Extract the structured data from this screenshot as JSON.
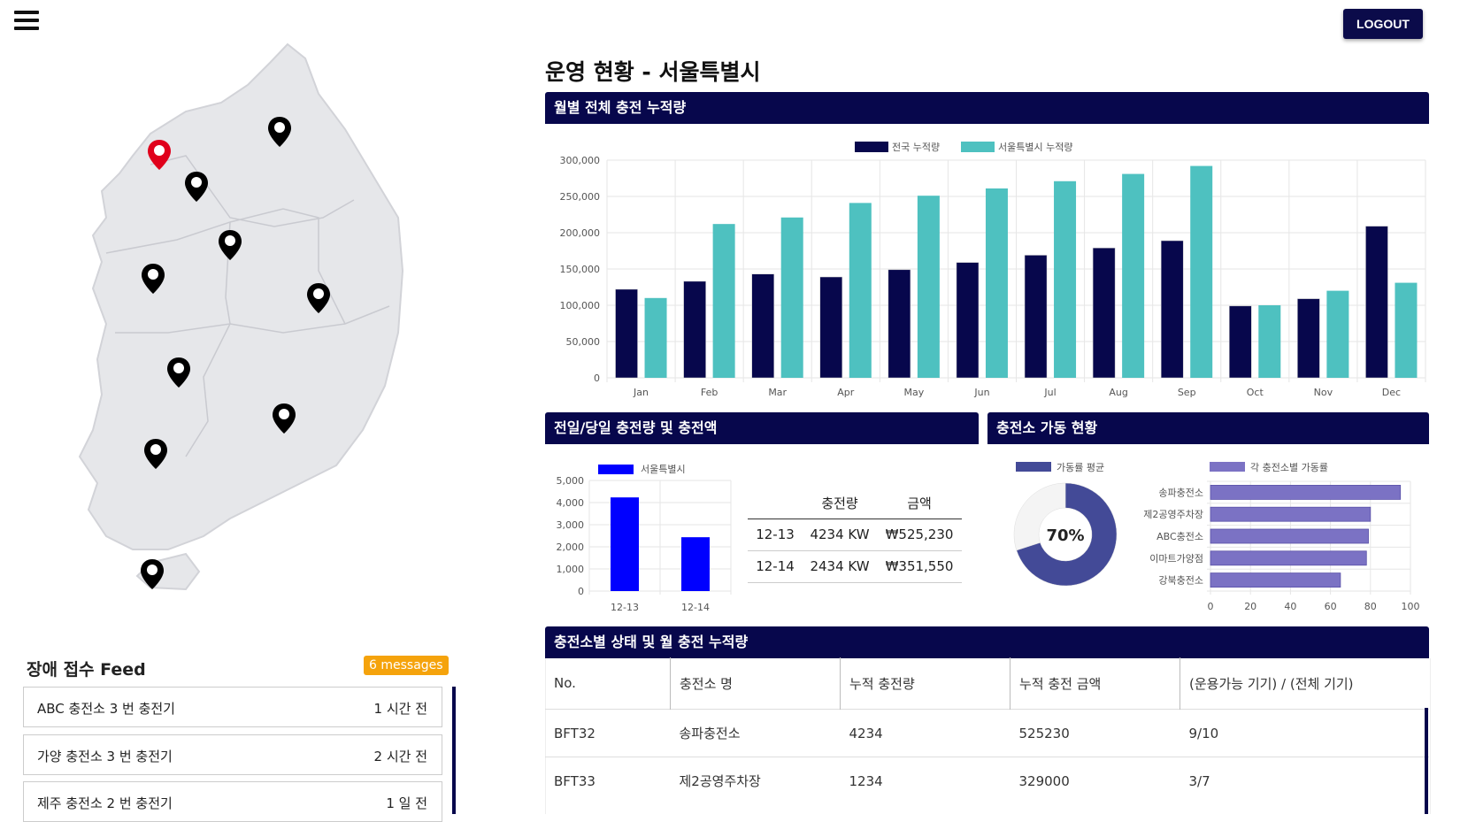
{
  "header": {
    "logout_label": "LOGOUT"
  },
  "page_title": "운영 현황 - 서울특별시",
  "monthly": {
    "title": "월별 전체 충전 누적량",
    "legend": [
      "전국 누적량",
      "서울특별시 누적량"
    ],
    "colors": [
      "#07074c",
      "#4ec1c0"
    ]
  },
  "daily": {
    "title": "전일/당일 충전량 및 충전액",
    "legend": "서울특별시",
    "table_headers": [
      "충전량",
      "금액"
    ],
    "rows": [
      {
        "date": "12-13",
        "amount": "4234 KW",
        "price": "₩525,230"
      },
      {
        "date": "12-14",
        "amount": "2434 KW",
        "price": "₩351,550"
      }
    ]
  },
  "operation": {
    "title": "충전소 가동 현황",
    "legend_avg": "가동률 평균",
    "legend_each": "각 충전소별 가동률",
    "avg_label": "70%",
    "avg_value": 70
  },
  "feed": {
    "title": "장애 접수 Feed",
    "badge": "6 messages",
    "items": [
      {
        "name": "ABC 충전소 3 번 충전기",
        "time": "1 시간 전"
      },
      {
        "name": "가양 충전소 3 번 충전기",
        "time": "2 시간 전"
      },
      {
        "name": "제주 충전소 2 번 충전기",
        "time": "1 일 전"
      }
    ]
  },
  "station_table": {
    "title": "충전소별 상태 및 월 충전 누적량",
    "headers": [
      "No.",
      "충전소 명",
      "누적 충전량",
      "누적 충전 금액",
      "(운용가능 기기) / (전체 기기)"
    ],
    "rows": [
      [
        "BFT32",
        "송파충전소",
        "4234",
        "525230",
        "9/10"
      ],
      [
        "BFT33",
        "제2공영주차장",
        "1234",
        "329000",
        "3/7"
      ]
    ]
  },
  "chart_data": [
    {
      "type": "bar",
      "categories": [
        "Jan",
        "Feb",
        "Mar",
        "Apr",
        "May",
        "Jun",
        "Jul",
        "Aug",
        "Sep",
        "Oct",
        "Nov",
        "Dec"
      ],
      "series": [
        {
          "name": "전국 누적량",
          "values": [
            122000,
            133000,
            143000,
            139000,
            149000,
            159000,
            169000,
            179000,
            189000,
            99000,
            109000,
            209000
          ]
        },
        {
          "name": "서울특별시 누적량",
          "values": [
            110000,
            212000,
            221000,
            241000,
            251000,
            261000,
            271000,
            281000,
            292000,
            100000,
            120000,
            131000
          ]
        }
      ],
      "ylim": [
        0,
        300000
      ],
      "yticks": [
        "0",
        "50,000",
        "100,000",
        "150,000",
        "200,000",
        "250,000",
        "300,000"
      ],
      "legend_position": "top",
      "grid": true
    },
    {
      "type": "bar",
      "categories": [
        "12-13",
        "12-14"
      ],
      "series": [
        {
          "name": "서울특별시",
          "values": [
            4234,
            2434
          ]
        }
      ],
      "ylim": [
        0,
        5000
      ],
      "yticks": [
        "0",
        "1,000",
        "2,000",
        "3,000",
        "4,000",
        "5,000"
      ],
      "color": "#0000ff",
      "legend_position": "top",
      "grid": true
    },
    {
      "type": "pie",
      "series": [
        {
          "name": "가동률 평균",
          "values": [
            70,
            30
          ]
        }
      ],
      "colors": [
        "#434a97",
        "#f4f4f4"
      ]
    },
    {
      "type": "bar",
      "orientation": "horizontal",
      "categories": [
        "송파충전소",
        "제2공영주차장",
        "ABC충전소",
        "이마트가양점",
        "강북충전소"
      ],
      "series": [
        {
          "name": "각 충전소별 가동률",
          "values": [
            95,
            80,
            79,
            78,
            65
          ]
        }
      ],
      "xlim": [
        0,
        100
      ],
      "xticks": [
        "0",
        "20",
        "40",
        "60",
        "80",
        "100"
      ],
      "color": "#7b72c4",
      "legend_position": "top",
      "grid": true
    }
  ]
}
